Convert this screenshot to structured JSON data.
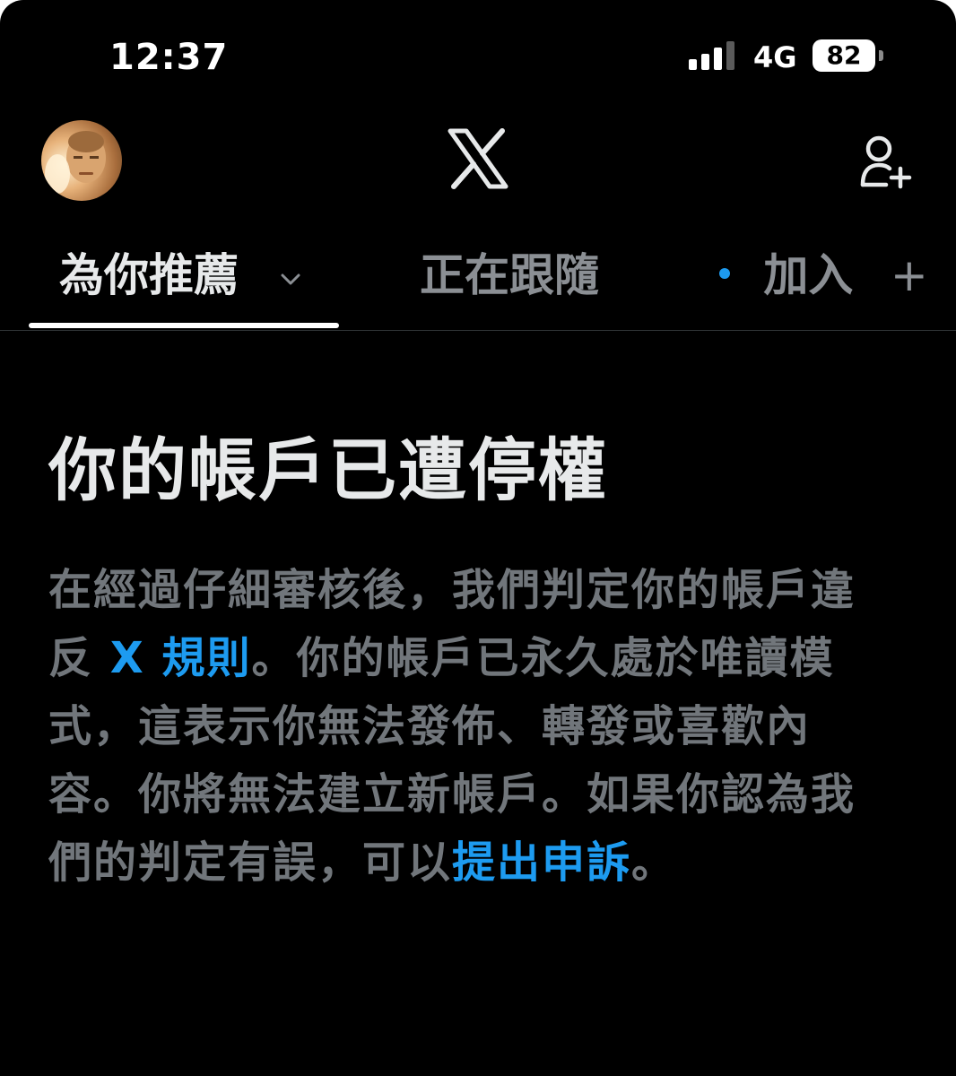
{
  "status_bar": {
    "time": "12:37",
    "network": "4G",
    "battery": "82"
  },
  "header": {
    "logo": "X"
  },
  "tabs": [
    {
      "label": "為你推薦"
    },
    {
      "label": "正在跟隨"
    },
    {
      "label": "加入"
    }
  ],
  "notice": {
    "title": "你的帳戶已遭停權",
    "body_part1": "在經過仔細審核後，我們判定你的帳戶違反 ",
    "rules_link": "X 規則",
    "body_part2": "。你的帳戶已永久處於唯讀模式，這表示你無法發佈、轉發或喜歡內容。你將無法建立新帳戶。如果你認為我們的判定有誤，可以",
    "appeal_link": "提出申訴",
    "body_part3": "。"
  },
  "colors": {
    "background": "#000000",
    "link": "#1d9bf0",
    "muted_text": "#71767b",
    "primary_text": "#e7e9ea"
  },
  "icons": [
    "signal-icon",
    "battery-icon",
    "avatar",
    "x-logo-icon",
    "add-user-icon",
    "chevron-down-icon",
    "plus-icon",
    "unread-dot-icon"
  ]
}
